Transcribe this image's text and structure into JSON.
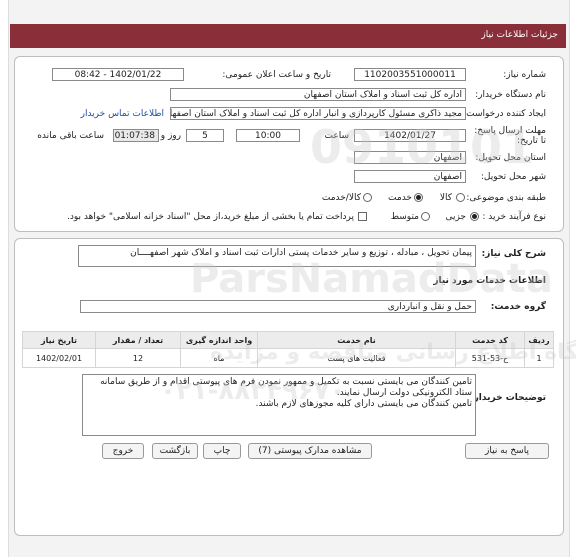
{
  "header": {
    "title": "جزئیات اطلاعات نیاز"
  },
  "info": {
    "need_number_label": "شماره نیاز:",
    "need_number": "1102003551000011",
    "announce_label": "تاریخ و ساعت اعلان عمومی:",
    "announce_value": "1402/01/22 - 08:42",
    "buyer_label": "نام دستگاه خریدار:",
    "buyer_value": "اداره کل ثبت اسناد و املاک استان اصفهان",
    "creator_label": "ایجاد کننده درخواست:",
    "creator_value": "مجید ذاکری مسئول کارپردازی و انبار اداره کل ثبت اسناد و املاک استان اصفهان",
    "contact_link": "اطلاعات تماس خریدار",
    "deadline_label": "مهلت ارسال پاسخ: تا تاریخ:",
    "deadline_date": "1402/01/27",
    "time_label": "ساعت",
    "deadline_time": "10:00",
    "days_value": "5",
    "days_label": "روز و",
    "remaining_time": "01:07:38",
    "remaining_label": "ساعت باقی مانده",
    "province_label": "استان محل تحویل:",
    "province_value": "اصفهان",
    "city_label": "شهر محل تحویل:",
    "city_value": "اصفهان",
    "category_label": "طبقه بندی موضوعی:",
    "category_options": [
      "کالا",
      "خدمت",
      "کالا/خدمت"
    ],
    "process_label": "نوع فرآیند خرید :",
    "process_options": [
      "جزیی",
      "متوسط"
    ],
    "payment_text": "پرداخت تمام یا بخشی از مبلغ خرید،از محل \"اسناد خزانه اسلامی\" خواهد بود."
  },
  "description": {
    "label": "شرح کلی نیاز:",
    "value": "پیمان تحویل ، مبادله ، توزیع و سایر خدمات پستی ادارات ثبت اسناد و املاک شهر اصفهــــان"
  },
  "services": {
    "section_title": "اطلاعات خدمات مورد نیاز",
    "group_label": "گروه خدمت:",
    "group_value": "حمل و نقل و انبارداری",
    "columns": [
      "ردیف",
      "کد خدمت",
      "نام خدمت",
      "واحد اندازه گیری",
      "تعداد / مقدار",
      "تاریخ نیاز"
    ],
    "rows": [
      {
        "row": "1",
        "code": "ح-53-531",
        "name": "فعالیت های پست",
        "unit": "ماه",
        "qty": "12",
        "date": "1402/02/01"
      }
    ]
  },
  "notes": {
    "label": "توضیحات خریدار:",
    "lines": [
      "تامین کنندگان می بایستی نسبت به تکمیل و ممهور نمودن فرم های پیوستی اقدام و از طریق سامانه",
      "ستاد الکترونیکی دولت ارسال نمایند.",
      "تامین کنندگان می بایستی دارای کلیه مجوزهای لازم باشند."
    ]
  },
  "buttons": {
    "reply": "پاسخ به نیاز",
    "attachments": "مشاهده مدارک پیوستی (7)",
    "print": "چاپ",
    "back": "بازگشت",
    "exit": "خروج"
  },
  "watermark": {
    "brand": "ParsNamadData",
    "subtitle": "پایگاه اطلاع رسانی مناقصه و مزایده",
    "phone": "۰۲۱-۸۸۳۴۹۶۷۰",
    "big_number": "0910101"
  }
}
